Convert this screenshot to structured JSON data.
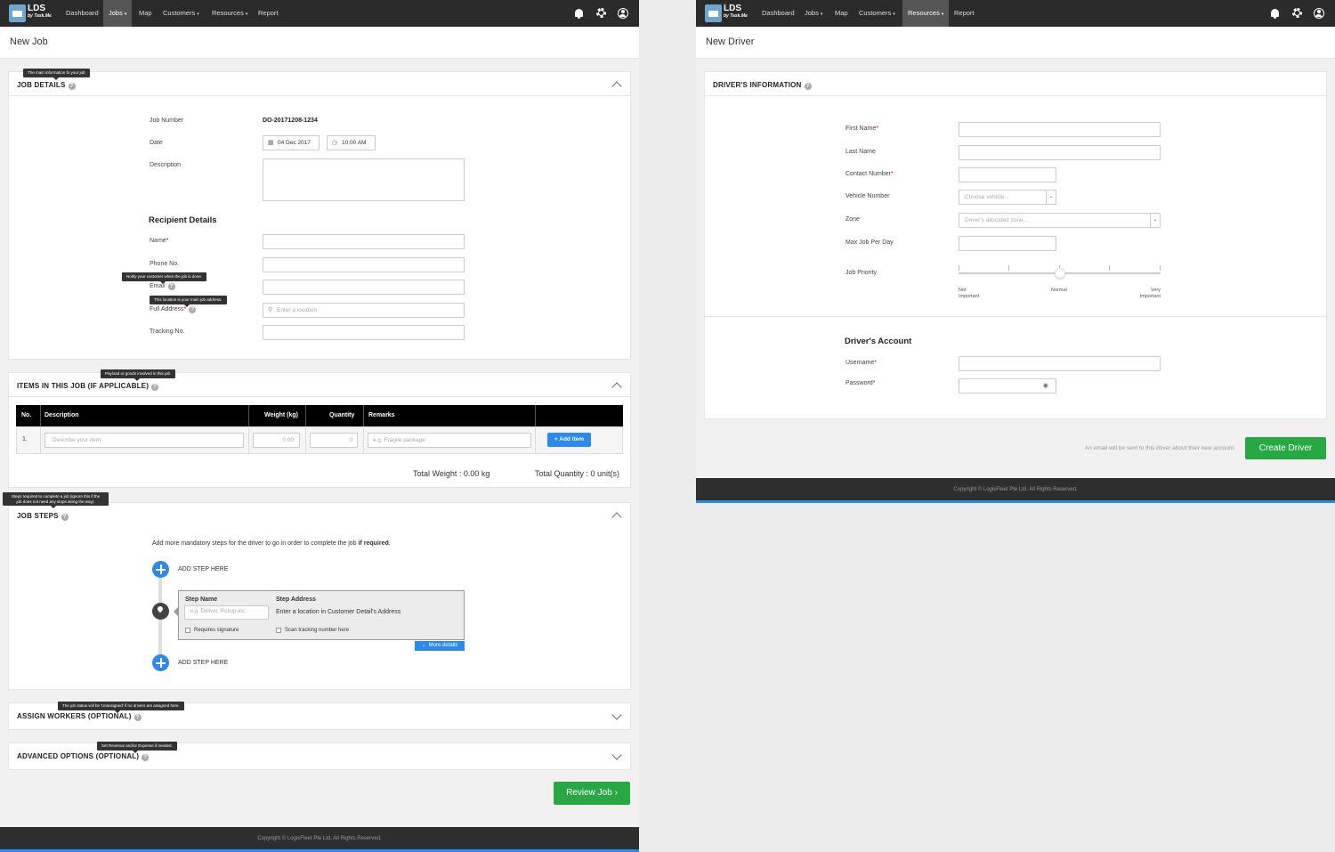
{
  "nav": {
    "logo_text": "LDS",
    "logo_sub": "by Task.Me",
    "items": [
      "Dashboard",
      "Jobs",
      "Map",
      "Customers",
      "Resources",
      "Report"
    ]
  },
  "left": {
    "page_title": "New Job",
    "job_details": {
      "title": "JOB DETAILS",
      "tooltip": "The main information fo your job",
      "job_number_label": "Job Number",
      "job_number_value": "DO-20171208-1234",
      "date_label": "Date",
      "date_value": "04 Dec 2017",
      "time_value": "10:00 AM",
      "description_label": "Description",
      "recipient_heading": "Recipient Details",
      "name_label": "Name",
      "phone_label": "Phone No.",
      "email_label": "Email",
      "email_tooltip": "Notify your customer when the job is done.",
      "address_label": "Full Address",
      "address_tooltip": "This location is your main job address.",
      "address_placeholder": "Enter a location",
      "tracking_label": "Tracking No."
    },
    "items": {
      "title": "ITEMS IN THIS JOB (IF APPLICABLE)",
      "tooltip": "Payload or goods involved in this job.",
      "columns": [
        "No.",
        "Description",
        "Weight (kg)",
        "Quantity",
        "Remarks"
      ],
      "row_no": "1.",
      "desc_placeholder": "Describe your item",
      "weight_placeholder": "0.00",
      "qty_placeholder": "0",
      "remarks_placeholder": "e.g. Fragile package",
      "add_button": "+ Add item",
      "total_weight": "Total Weight : 0.00 kg",
      "total_quantity": "Total Quantity : 0 unit(s)"
    },
    "job_steps": {
      "title": "JOB STEPS",
      "tooltip_line1": "Steps required to complete a job (ignore this if the",
      "tooltip_line2": "job does not need any stops along the way).",
      "intro": "Add more mandatory steps for the driver to go in order to complete the job",
      "intro_bold": "if required",
      "add_step": "ADD STEP HERE",
      "step_name_label": "Step Name",
      "step_name_placeholder": "e.g. Deliver, Pickup etc.",
      "step_address_label": "Step Address",
      "step_address_value": "Enter a location in Customer Detail's Address",
      "requires_signature": "Requires signature",
      "scan_tracking": "Scan tracking number here",
      "more_details": "More details"
    },
    "assign": {
      "title": "ASSIGN WORKERS (OPTIONAL)",
      "tooltip": "The job status will be 'Unassigned' if no drivers are assigned here."
    },
    "advanced": {
      "title": "ADVANCED OPTIONS (OPTIONAL)",
      "tooltip": "Set Revenue and/or Expense if needed."
    },
    "review_button": "Review Job",
    "footer": "Copyright © LogisFleet Pte Ltd. All Rights Reserved."
  },
  "right": {
    "page_title": "New Driver",
    "info_title": "DRIVER'S INFORMATION",
    "first_name_label": "First Name",
    "last_name_label": "Last Name",
    "contact_label": "Contact Number",
    "vehicle_label": "Vehicle Number",
    "vehicle_placeholder": "Choose vehicle...",
    "zone_label": "Zone",
    "zone_placeholder": "Driver's allocated zone...",
    "max_job_label": "Max Job Per Day",
    "priority_label": "Job Priority",
    "priority_low_1": "Not",
    "priority_low_2": "Important",
    "priority_mid": "Normal",
    "priority_high_1": "Very",
    "priority_high_2": "Important",
    "priority_level": 0.5,
    "account_heading": "Driver's Account",
    "username_label": "Username",
    "password_label": "Password",
    "email_note": "An email will be sent to this driver about their new account.",
    "create_button": "Create Driver",
    "footer": "Copyright © LogisFleet Pte Ltd. All Rights Reserved."
  },
  "colors": {
    "nav_bg": "#2b2b2b",
    "accent_blue": "#2d8ae8",
    "success_green": "#27a844",
    "required_red": "#d0021b"
  }
}
